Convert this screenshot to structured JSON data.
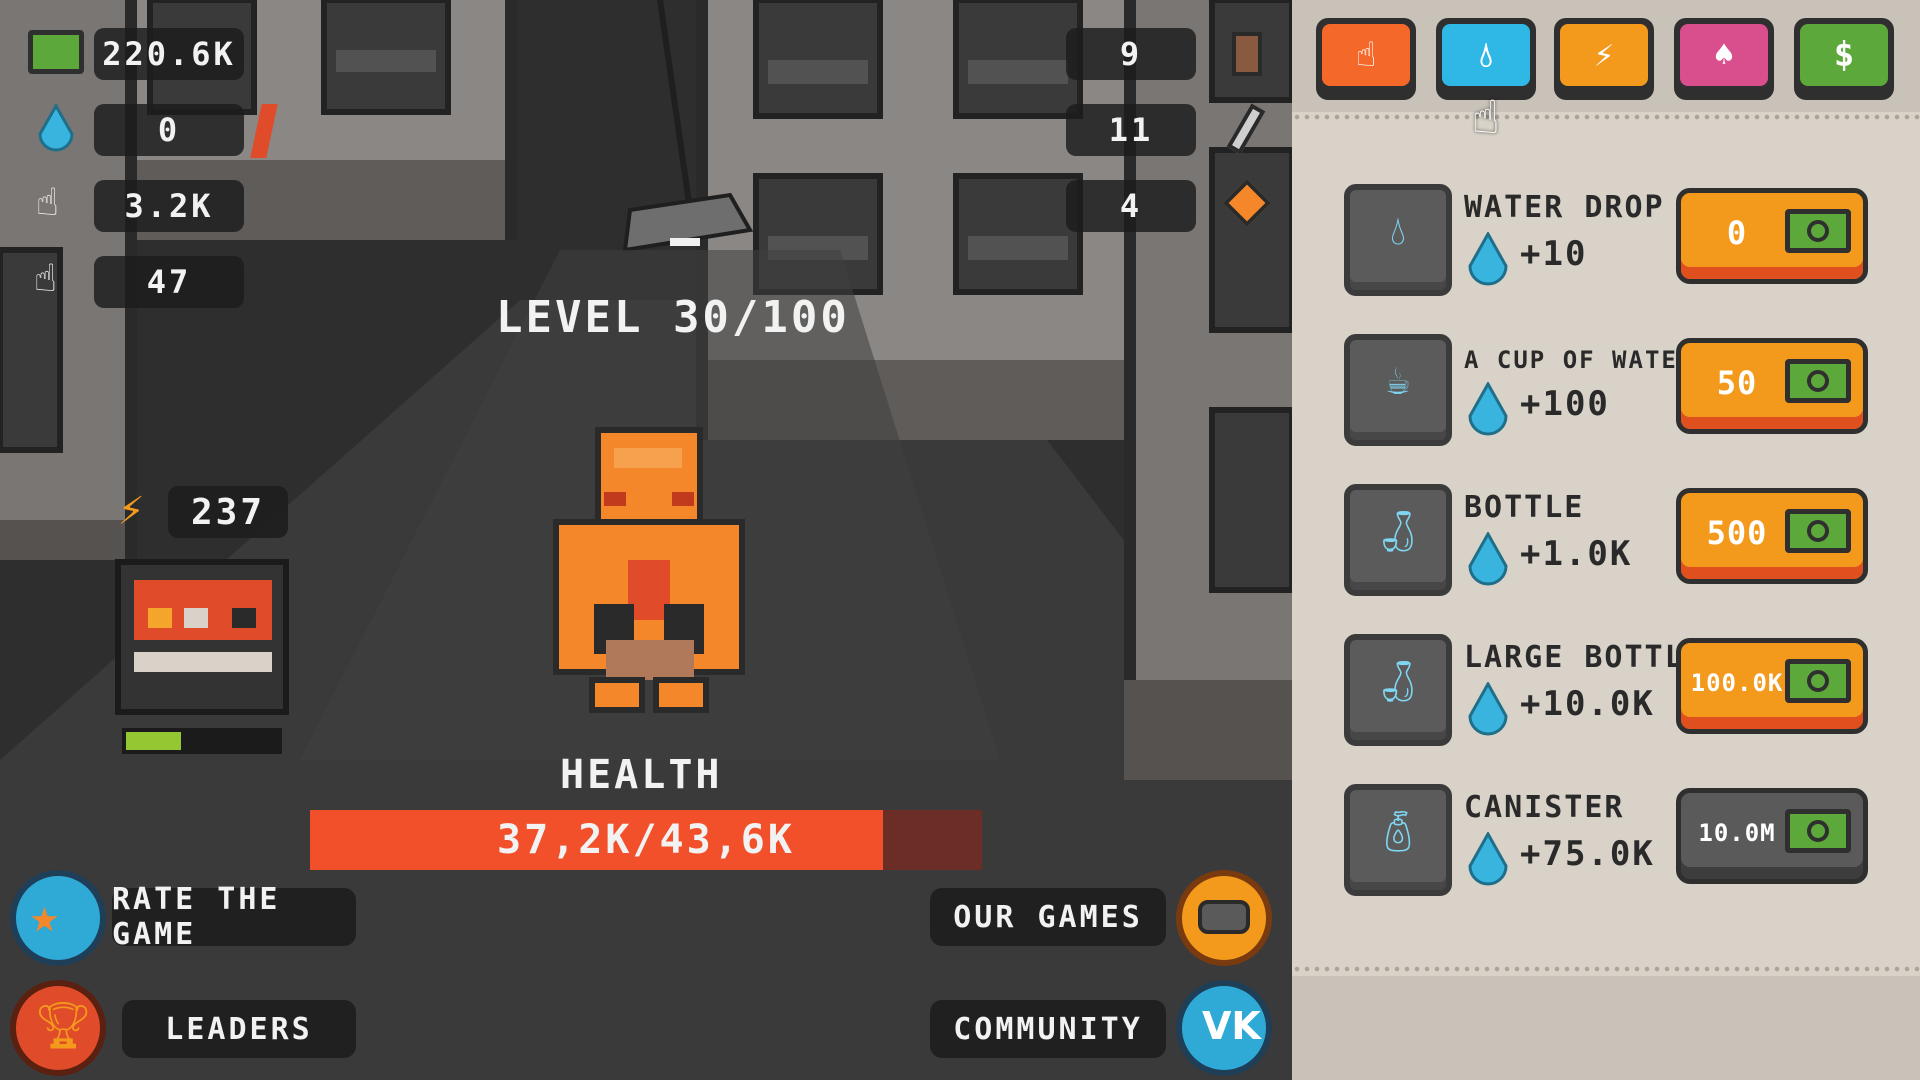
{
  "hud": {
    "cash": "220.6K",
    "water": "0",
    "click_power": "3.2K",
    "auto_clicks": "47",
    "counter_top": "9",
    "counter_mid": "11",
    "counter_low": "4",
    "energy": "237",
    "energy_fill_fraction": 0.36
  },
  "level": {
    "text": "LEVEL 30/100"
  },
  "health": {
    "label": "HEALTH",
    "text": "37,2K/43,6K",
    "current": 37200,
    "max": 43600
  },
  "menu": {
    "rate": "RATE THE GAME",
    "leaders": "LEADERS",
    "our_games": "OUR GAMES",
    "community": "COMMUNITY"
  },
  "tabs": [
    {
      "icon": "hand-icon",
      "color": "#f4682a"
    },
    {
      "icon": "water-drop-icon",
      "color": "#2fb8e6",
      "active": true
    },
    {
      "icon": "lightning-icon",
      "color": "#f39a1d"
    },
    {
      "icon": "muscle-icon",
      "color": "#d94f8e"
    },
    {
      "icon": "dollar-icon",
      "color": "#5da83a"
    }
  ],
  "items": [
    {
      "name": "WATER DROP",
      "gain": "+10",
      "price": "0",
      "icon": "water-drop-icon",
      "style": "orange"
    },
    {
      "name": "A CUP OF WATER",
      "gain": "+100",
      "price": "50",
      "icon": "cup-icon",
      "style": "orange"
    },
    {
      "name": "BOTTLE",
      "gain": "+1.0K",
      "price": "500",
      "icon": "bottle-icon",
      "style": "orange"
    },
    {
      "name": "LARGE BOTTLE",
      "gain": "+10.0K",
      "price": "100.0K",
      "icon": "large-bottle-icon",
      "style": "orange"
    },
    {
      "name": "CANISTER",
      "gain": "+75.0K",
      "price": "10.0M",
      "icon": "canister-icon",
      "style": "gray"
    }
  ]
}
